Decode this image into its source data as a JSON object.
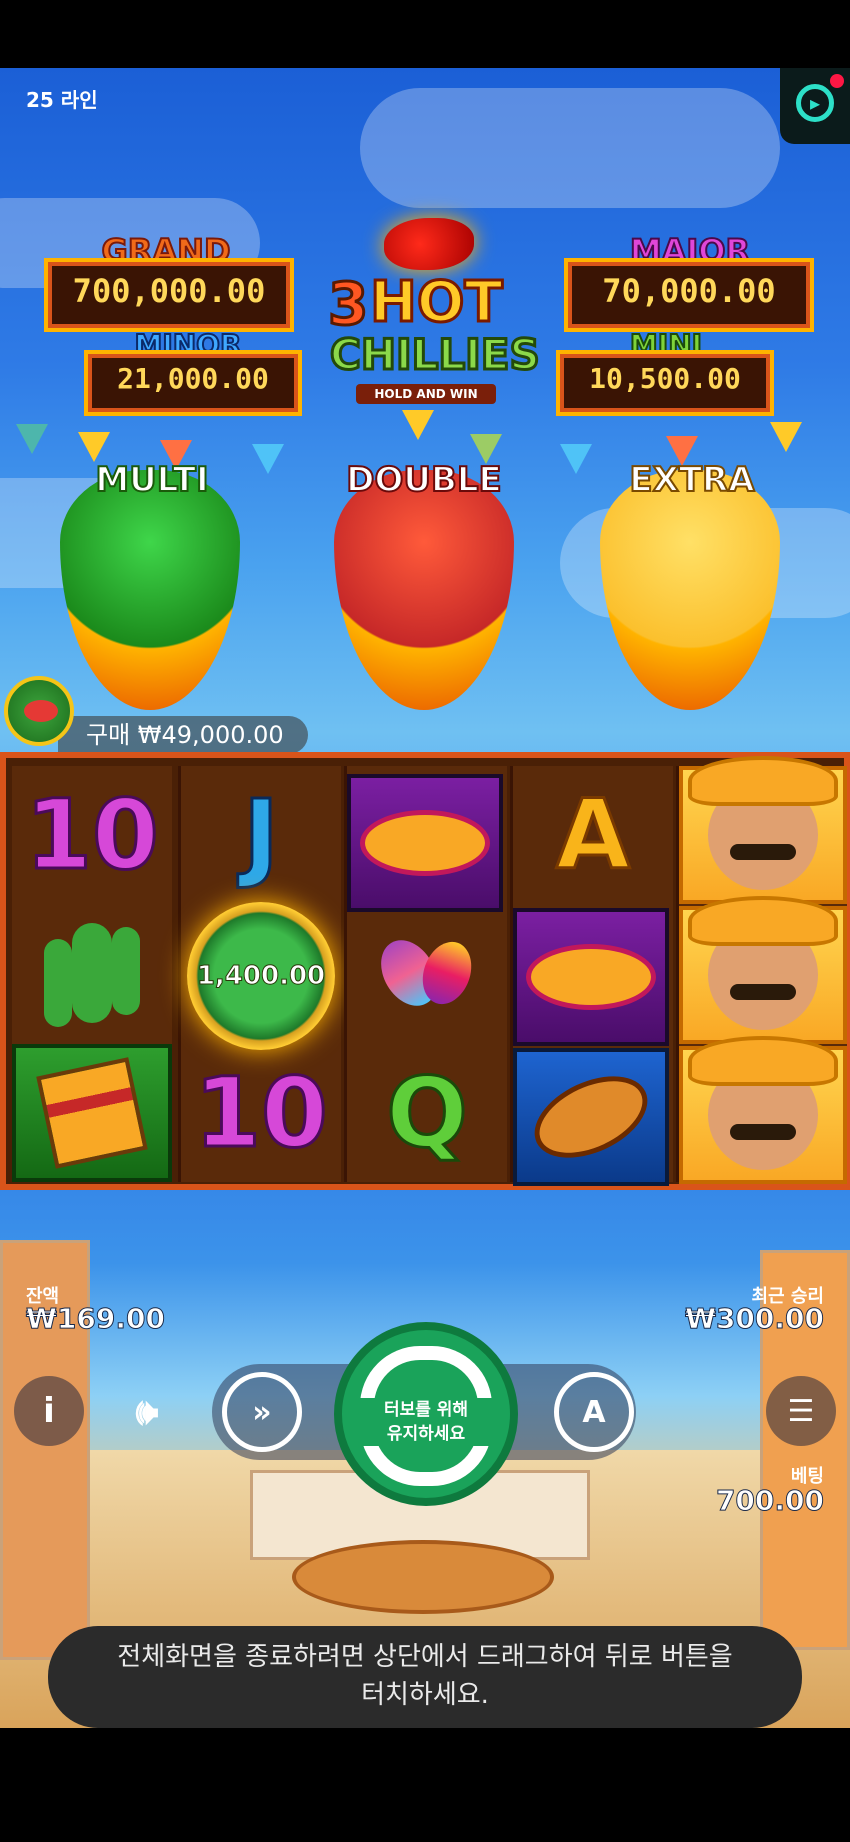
{
  "hud_top": {
    "lines_label": "25 라인"
  },
  "jackpots": {
    "grand": {
      "label": "GRAND",
      "value": "700,000.00"
    },
    "minor": {
      "label": "MINOR",
      "value": "21,000.00"
    },
    "major": {
      "label": "MAJOR",
      "value": "70,000.00"
    },
    "mini": {
      "label": "MINI",
      "value": "10,500.00"
    }
  },
  "logo": {
    "number": "3",
    "hot": "HOT",
    "chillies": "CHILLIES",
    "tagline": "HOLD AND WIN"
  },
  "bonus": {
    "multi": "MULTI",
    "double": "DOUBLE",
    "extra": "EXTRA"
  },
  "buy": {
    "label": "구매 ₩49,000.00"
  },
  "reels": {
    "col1": [
      "10",
      "cactus",
      "gift-box"
    ],
    "col2": [
      "J",
      "1,400.00",
      "10"
    ],
    "col3": [
      "sombrero",
      "maracas",
      "Q"
    ],
    "col4": [
      "A",
      "sombrero",
      "guitar"
    ],
    "col5": [
      "mariachi",
      "mariachi",
      "mariachi"
    ],
    "letters": {
      "ten": "10",
      "j": "J",
      "a": "A",
      "q": "Q"
    },
    "coin_value": "1,400.00"
  },
  "hud": {
    "balance_label": "잔액",
    "balance_value": "₩169.00",
    "last_win_label": "최근 승리",
    "last_win_value": "₩300.00",
    "bet_label": "베팅",
    "bet_value": "700.00",
    "info_glyph": "i",
    "autoplay_glyph": "A",
    "spin_hint_line1": "터보를 위해",
    "spin_hint_line2": "유지하세요"
  },
  "toast": {
    "line1": "전체화면을 종료하려면 상단에서 드래그하여 뒤로 버튼을",
    "line2": "터치하세요."
  },
  "colors": {
    "grand": "#f06a1a",
    "minor": "#3fa8ff",
    "major": "#e046d8",
    "mini": "#7fd33a",
    "spin": "#1aa35a"
  }
}
